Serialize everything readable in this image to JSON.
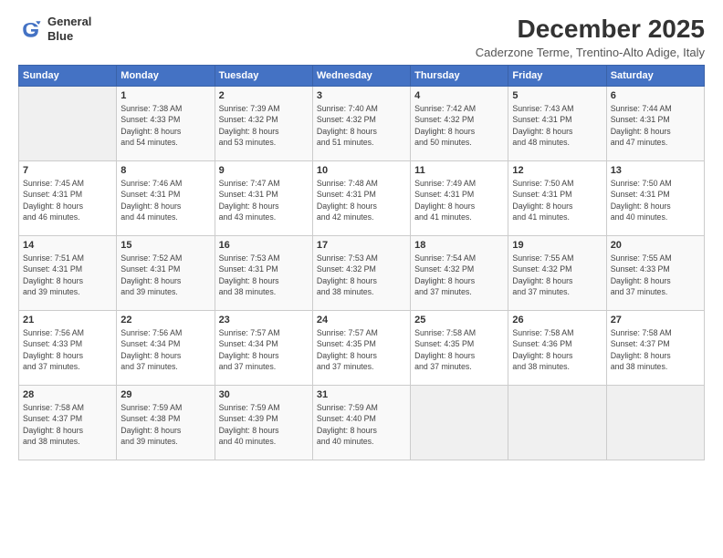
{
  "logo": {
    "line1": "General",
    "line2": "Blue"
  },
  "title": "December 2025",
  "subtitle": "Caderzone Terme, Trentino-Alto Adige, Italy",
  "days_of_week": [
    "Sunday",
    "Monday",
    "Tuesday",
    "Wednesday",
    "Thursday",
    "Friday",
    "Saturday"
  ],
  "weeks": [
    [
      {
        "day": "",
        "detail": ""
      },
      {
        "day": "1",
        "detail": "Sunrise: 7:38 AM\nSunset: 4:33 PM\nDaylight: 8 hours\nand 54 minutes."
      },
      {
        "day": "2",
        "detail": "Sunrise: 7:39 AM\nSunset: 4:32 PM\nDaylight: 8 hours\nand 53 minutes."
      },
      {
        "day": "3",
        "detail": "Sunrise: 7:40 AM\nSunset: 4:32 PM\nDaylight: 8 hours\nand 51 minutes."
      },
      {
        "day": "4",
        "detail": "Sunrise: 7:42 AM\nSunset: 4:32 PM\nDaylight: 8 hours\nand 50 minutes."
      },
      {
        "day": "5",
        "detail": "Sunrise: 7:43 AM\nSunset: 4:31 PM\nDaylight: 8 hours\nand 48 minutes."
      },
      {
        "day": "6",
        "detail": "Sunrise: 7:44 AM\nSunset: 4:31 PM\nDaylight: 8 hours\nand 47 minutes."
      }
    ],
    [
      {
        "day": "7",
        "detail": "Sunrise: 7:45 AM\nSunset: 4:31 PM\nDaylight: 8 hours\nand 46 minutes."
      },
      {
        "day": "8",
        "detail": "Sunrise: 7:46 AM\nSunset: 4:31 PM\nDaylight: 8 hours\nand 44 minutes."
      },
      {
        "day": "9",
        "detail": "Sunrise: 7:47 AM\nSunset: 4:31 PM\nDaylight: 8 hours\nand 43 minutes."
      },
      {
        "day": "10",
        "detail": "Sunrise: 7:48 AM\nSunset: 4:31 PM\nDaylight: 8 hours\nand 42 minutes."
      },
      {
        "day": "11",
        "detail": "Sunrise: 7:49 AM\nSunset: 4:31 PM\nDaylight: 8 hours\nand 41 minutes."
      },
      {
        "day": "12",
        "detail": "Sunrise: 7:50 AM\nSunset: 4:31 PM\nDaylight: 8 hours\nand 41 minutes."
      },
      {
        "day": "13",
        "detail": "Sunrise: 7:50 AM\nSunset: 4:31 PM\nDaylight: 8 hours\nand 40 minutes."
      }
    ],
    [
      {
        "day": "14",
        "detail": "Sunrise: 7:51 AM\nSunset: 4:31 PM\nDaylight: 8 hours\nand 39 minutes."
      },
      {
        "day": "15",
        "detail": "Sunrise: 7:52 AM\nSunset: 4:31 PM\nDaylight: 8 hours\nand 39 minutes."
      },
      {
        "day": "16",
        "detail": "Sunrise: 7:53 AM\nSunset: 4:31 PM\nDaylight: 8 hours\nand 38 minutes."
      },
      {
        "day": "17",
        "detail": "Sunrise: 7:53 AM\nSunset: 4:32 PM\nDaylight: 8 hours\nand 38 minutes."
      },
      {
        "day": "18",
        "detail": "Sunrise: 7:54 AM\nSunset: 4:32 PM\nDaylight: 8 hours\nand 37 minutes."
      },
      {
        "day": "19",
        "detail": "Sunrise: 7:55 AM\nSunset: 4:32 PM\nDaylight: 8 hours\nand 37 minutes."
      },
      {
        "day": "20",
        "detail": "Sunrise: 7:55 AM\nSunset: 4:33 PM\nDaylight: 8 hours\nand 37 minutes."
      }
    ],
    [
      {
        "day": "21",
        "detail": "Sunrise: 7:56 AM\nSunset: 4:33 PM\nDaylight: 8 hours\nand 37 minutes."
      },
      {
        "day": "22",
        "detail": "Sunrise: 7:56 AM\nSunset: 4:34 PM\nDaylight: 8 hours\nand 37 minutes."
      },
      {
        "day": "23",
        "detail": "Sunrise: 7:57 AM\nSunset: 4:34 PM\nDaylight: 8 hours\nand 37 minutes."
      },
      {
        "day": "24",
        "detail": "Sunrise: 7:57 AM\nSunset: 4:35 PM\nDaylight: 8 hours\nand 37 minutes."
      },
      {
        "day": "25",
        "detail": "Sunrise: 7:58 AM\nSunset: 4:35 PM\nDaylight: 8 hours\nand 37 minutes."
      },
      {
        "day": "26",
        "detail": "Sunrise: 7:58 AM\nSunset: 4:36 PM\nDaylight: 8 hours\nand 38 minutes."
      },
      {
        "day": "27",
        "detail": "Sunrise: 7:58 AM\nSunset: 4:37 PM\nDaylight: 8 hours\nand 38 minutes."
      }
    ],
    [
      {
        "day": "28",
        "detail": "Sunrise: 7:58 AM\nSunset: 4:37 PM\nDaylight: 8 hours\nand 38 minutes."
      },
      {
        "day": "29",
        "detail": "Sunrise: 7:59 AM\nSunset: 4:38 PM\nDaylight: 8 hours\nand 39 minutes."
      },
      {
        "day": "30",
        "detail": "Sunrise: 7:59 AM\nSunset: 4:39 PM\nDaylight: 8 hours\nand 40 minutes."
      },
      {
        "day": "31",
        "detail": "Sunrise: 7:59 AM\nSunset: 4:40 PM\nDaylight: 8 hours\nand 40 minutes."
      },
      {
        "day": "",
        "detail": ""
      },
      {
        "day": "",
        "detail": ""
      },
      {
        "day": "",
        "detail": ""
      }
    ]
  ]
}
